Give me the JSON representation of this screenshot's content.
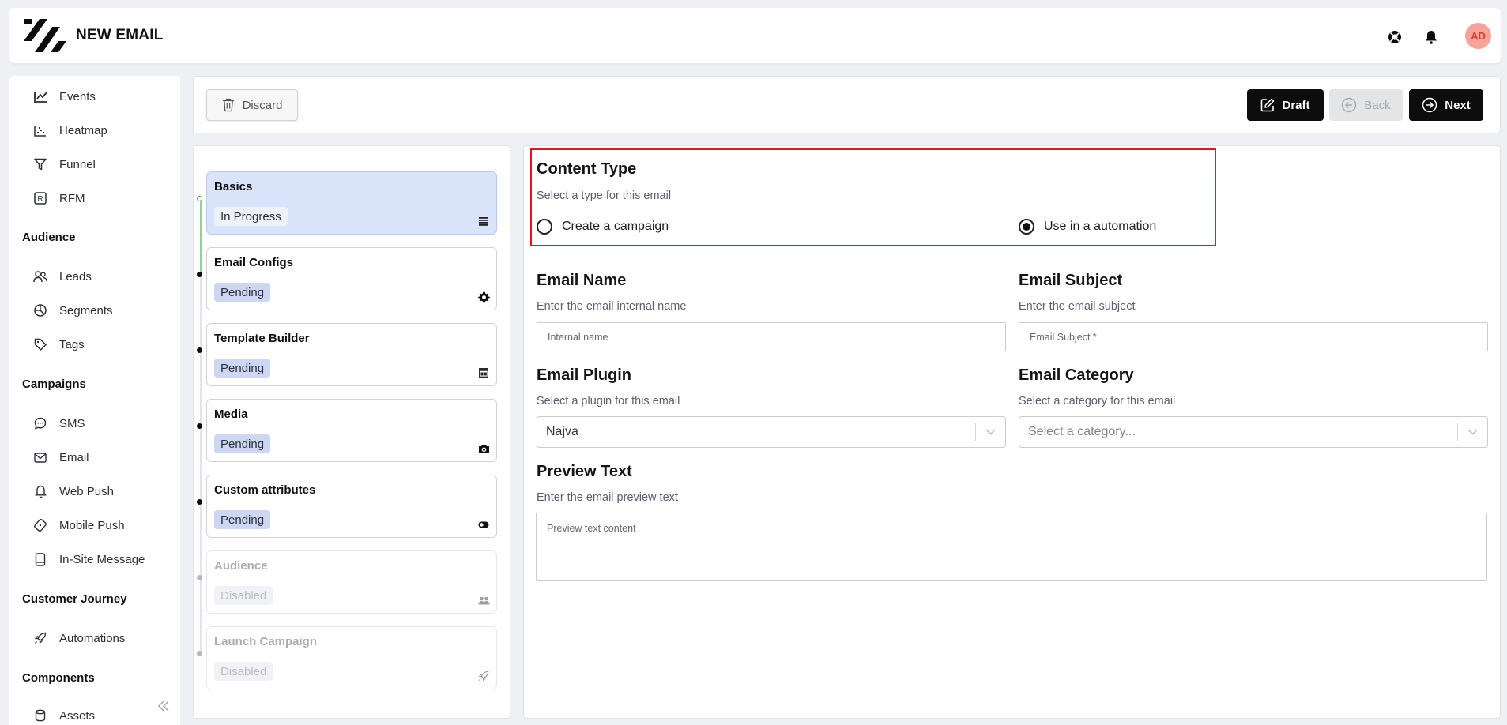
{
  "header": {
    "title": "NEW EMAIL",
    "avatar_initials": "AD",
    "icons": [
      "support-icon",
      "bell-icon"
    ]
  },
  "sidebar": {
    "items_top": [
      {
        "label": "Events",
        "icon": "line-chart-icon"
      },
      {
        "label": "Heatmap",
        "icon": "heatmap-icon"
      },
      {
        "label": "Funnel",
        "icon": "funnel-icon"
      },
      {
        "label": "RFM",
        "icon": "rfm-icon"
      }
    ],
    "sections": [
      {
        "title": "Audience",
        "items": [
          {
            "label": "Leads",
            "icon": "users-icon"
          },
          {
            "label": "Segments",
            "icon": "pie-icon"
          },
          {
            "label": "Tags",
            "icon": "tag-icon"
          }
        ]
      },
      {
        "title": "Campaigns",
        "items": [
          {
            "label": "SMS",
            "icon": "chat-icon"
          },
          {
            "label": "Email",
            "icon": "mail-icon"
          },
          {
            "label": "Web Push",
            "icon": "bell-icon"
          },
          {
            "label": "Mobile Push",
            "icon": "mobile-push-icon"
          },
          {
            "label": "In-Site Message",
            "icon": "message-icon"
          }
        ]
      },
      {
        "title": "Customer Journey",
        "items": [
          {
            "label": "Automations",
            "icon": "rocket-icon"
          }
        ]
      },
      {
        "title": "Components",
        "items": [
          {
            "label": "Assets",
            "icon": "database-icon"
          }
        ]
      }
    ]
  },
  "toolbar": {
    "discard_label": "Discard",
    "draft_label": "Draft",
    "back_label": "Back",
    "next_label": "Next"
  },
  "steps": [
    {
      "title": "Basics",
      "status": "In Progress",
      "icon": "list-icon",
      "state": "active"
    },
    {
      "title": "Email Configs",
      "status": "Pending",
      "icon": "gear-icon",
      "state": "pending"
    },
    {
      "title": "Template Builder",
      "status": "Pending",
      "icon": "template-icon",
      "state": "pending"
    },
    {
      "title": "Media",
      "status": "Pending",
      "icon": "camera-icon",
      "state": "pending"
    },
    {
      "title": "Custom attributes",
      "status": "Pending",
      "icon": "toggle-icon",
      "state": "pending"
    },
    {
      "title": "Audience",
      "status": "Disabled",
      "icon": "users-icon",
      "state": "disabled"
    },
    {
      "title": "Launch Campaign",
      "status": "Disabled",
      "icon": "rocket-icon",
      "state": "disabled"
    }
  ],
  "form": {
    "content_type": {
      "title": "Content Type",
      "subtitle": "Select a type for this email",
      "options": [
        "Create a campaign",
        "Use in a automation"
      ],
      "selected": "Use in a automation"
    },
    "email_name": {
      "title": "Email Name",
      "subtitle": "Enter the email internal name",
      "placeholder": "Internal name",
      "value": ""
    },
    "email_subject": {
      "title": "Email Subject",
      "subtitle": "Enter the email subject",
      "placeholder": "Email Subject *",
      "value": ""
    },
    "email_plugin": {
      "title": "Email Plugin",
      "subtitle": "Select a plugin for this email",
      "value": "Najva"
    },
    "email_category": {
      "title": "Email Category",
      "subtitle": "Select a category for this email",
      "placeholder": "Select a category..."
    },
    "preview_text": {
      "title": "Preview Text",
      "subtitle": "Enter the email preview text",
      "placeholder": "Preview text content"
    }
  },
  "colors": {
    "highlight_border": "#e3141b",
    "active_step_bg": "#d9e4fb",
    "pending_badge_bg": "#cdd7f3",
    "avatar_bg": "#f6a39a",
    "avatar_text": "#d3412f",
    "primary_button": "#0d0d0d"
  }
}
